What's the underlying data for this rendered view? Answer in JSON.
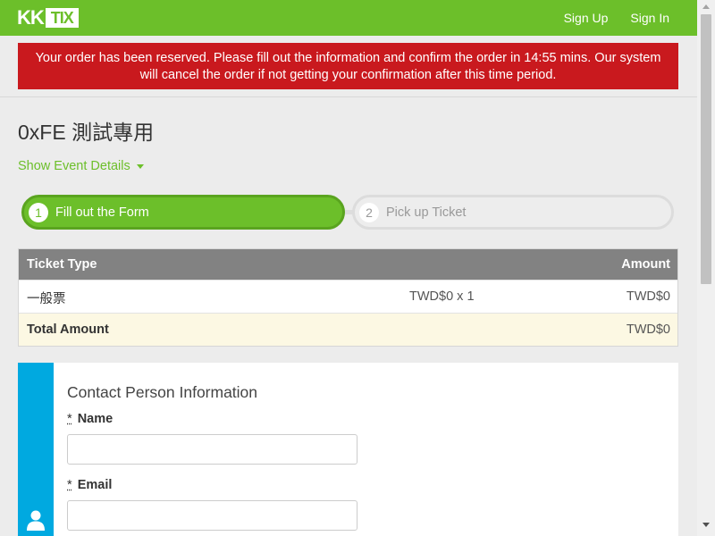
{
  "navbar": {
    "logo_k": "KK",
    "logo_tix": "TIX",
    "sign_up": "Sign Up",
    "sign_in": "Sign In"
  },
  "alert": {
    "message": "Your order has been reserved. Please fill out the information and confirm the order in 14:55 mins. Our system will cancel the order if not getting your confirmation after this time period."
  },
  "event": {
    "title": "0xFE 測試專用",
    "show_details": "Show Event Details"
  },
  "steps": [
    {
      "number": "1",
      "label": "Fill out the Form",
      "active": true
    },
    {
      "number": "2",
      "label": "Pick up Ticket",
      "active": false
    }
  ],
  "ticket_table": {
    "headers": {
      "type": "Ticket Type",
      "amount": "Amount"
    },
    "rows": [
      {
        "type": "一般票",
        "qty": "TWD$0 x 1",
        "amount": "TWD$0"
      }
    ],
    "total_label": "Total Amount",
    "total_amount": "TWD$0"
  },
  "contact_form": {
    "heading": "Contact Person Information",
    "required_mark": "*",
    "fields": [
      {
        "label": "Name",
        "value": ""
      },
      {
        "label": "Email",
        "value": ""
      }
    ],
    "icon": "user-icon"
  },
  "colors": {
    "brand_green": "#6cbf2a",
    "alert_red": "#c9191e",
    "panel_blue": "#00a9e0",
    "total_row_bg": "#fcf8e3",
    "table_header_gray": "#828282"
  }
}
